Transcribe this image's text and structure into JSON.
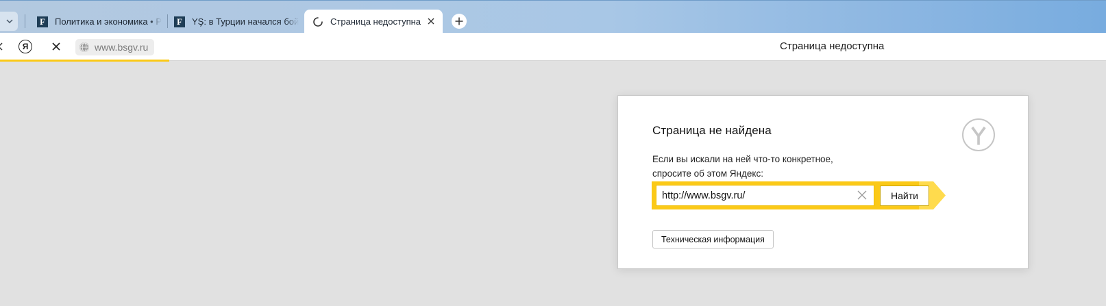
{
  "tabs": [
    {
      "label": "Политика и экономика • Р",
      "favicon": "F"
    },
    {
      "label": "YŞ: в Турции начался бой",
      "favicon": "F"
    },
    {
      "label": "Страница недоступна",
      "active": true
    }
  ],
  "toolbar": {
    "yandex_button": "Я",
    "url": "www.bsgv.ru",
    "page_title": "Страница недоступна"
  },
  "error": {
    "title": "Страница не найдена",
    "text_line1": "Если вы искали на ней что-то конкретное,",
    "text_line2": "спросите об этом Яндекс:",
    "search_value": "http://www.bsgv.ru/",
    "search_button": "Найти",
    "tech_button": "Техническая информация"
  },
  "colors": {
    "accent_yellow": "#fbc917",
    "search_arrow": "#ffdb4d",
    "tab_strip": "#a8c7e6",
    "page_background": "#e1e1e1"
  }
}
